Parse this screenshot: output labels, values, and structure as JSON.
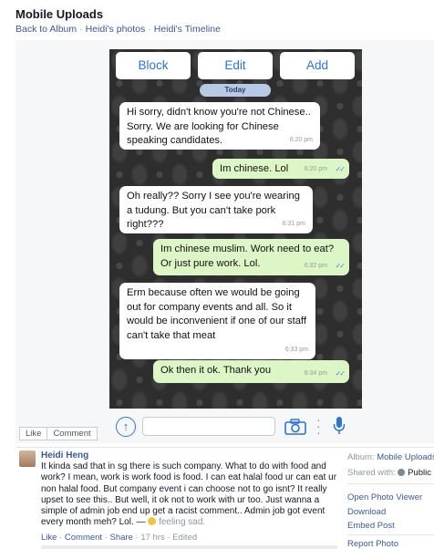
{
  "header": {
    "title": "Mobile Uploads",
    "breadcrumbs": [
      "Back to Album",
      "Heidi's photos",
      "Heidi's Timeline"
    ],
    "separator": "·"
  },
  "chat": {
    "top_buttons": [
      "Block",
      "Edit",
      "Add"
    ],
    "date_pill": "Today",
    "messages": [
      {
        "dir": "in",
        "text": "Hi sorry, didn't know you're not Chinese.. Sorry. We are looking for Chinese speaking candidates.",
        "time": "6:20 pm"
      },
      {
        "dir": "out",
        "text": "Im chinese. Lol",
        "time": "6:20 pm"
      },
      {
        "dir": "in",
        "text": "Oh really?? Sorry I see you're wearing a tudung. But you can't take pork right???",
        "time": "6:31 pm"
      },
      {
        "dir": "out",
        "text": "Im chinese muslim. Work need to eat? Or just pure work. Lol.",
        "time": "6:32 pm"
      },
      {
        "dir": "in",
        "text": "Erm because often we would be going out for company events and all. So it would be inconvenient if one of our staff can't take that meat",
        "time": "6:33 pm"
      },
      {
        "dir": "out",
        "text": "Ok then it ok. Thank you",
        "time": "6:34 pm"
      }
    ],
    "read_ticks": "✓✓",
    "input_icons": [
      "arrow-up-icon",
      "camera-icon",
      "more-dots-icon",
      "microphone-icon"
    ]
  },
  "actions": {
    "like": "Like",
    "comment": "Comment"
  },
  "post": {
    "author": "Heidi Heng",
    "text": "It kinda sad that in sg there is such company. What to do with food and work? I mean, work is work food is food. I can eat halal food ur can eat ur non halal food. But company event i can choose not to go isnt? It really upset to see this.. But well, it ok not to work with ur too. Just wanna a simple of admin job end up get a racist comment.. Admin job got event every month meh? Lol. —",
    "feeling": "feeling sad.",
    "meta": {
      "like": "Like",
      "comment": "Comment",
      "share": "Share",
      "time": "17 hrs",
      "edited": "Edited"
    }
  },
  "sidebar": {
    "album_label": "Album:",
    "album_name": "Mobile Uploads",
    "shared_label": "Shared with:",
    "shared_value": "Public",
    "links": [
      "Open Photo Viewer",
      "Download",
      "Embed Post"
    ],
    "report": "Report Photo"
  },
  "colors": {
    "link": "#3b5998",
    "ios_blue": "#2c74d6",
    "bubble_out": "#dcf6c6",
    "bubble_in": "#ffffff",
    "chat_bg": "#2e2e2e"
  }
}
